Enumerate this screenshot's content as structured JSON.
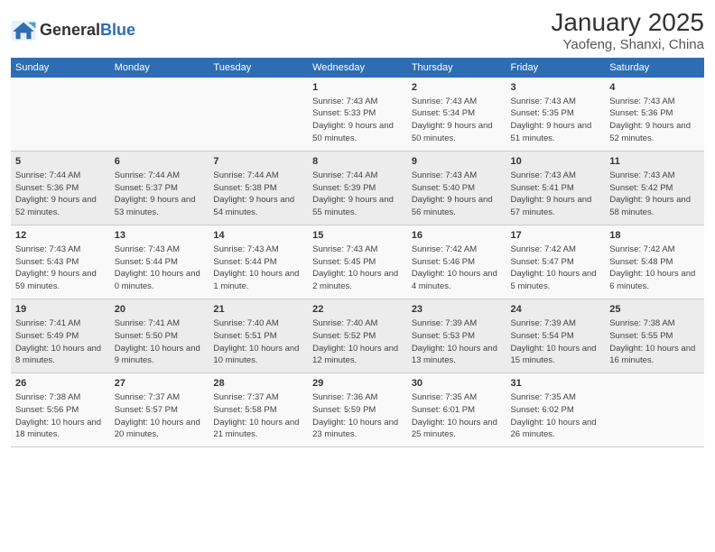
{
  "header": {
    "logo_general": "General",
    "logo_blue": "Blue",
    "title": "January 2025",
    "subtitle": "Yaofeng, Shanxi, China"
  },
  "weekdays": [
    "Sunday",
    "Monday",
    "Tuesday",
    "Wednesday",
    "Thursday",
    "Friday",
    "Saturday"
  ],
  "weeks": [
    [
      {
        "day": "",
        "sunrise": "",
        "sunset": "",
        "daylight": ""
      },
      {
        "day": "",
        "sunrise": "",
        "sunset": "",
        "daylight": ""
      },
      {
        "day": "",
        "sunrise": "",
        "sunset": "",
        "daylight": ""
      },
      {
        "day": "1",
        "sunrise": "Sunrise: 7:43 AM",
        "sunset": "Sunset: 5:33 PM",
        "daylight": "Daylight: 9 hours and 50 minutes."
      },
      {
        "day": "2",
        "sunrise": "Sunrise: 7:43 AM",
        "sunset": "Sunset: 5:34 PM",
        "daylight": "Daylight: 9 hours and 50 minutes."
      },
      {
        "day": "3",
        "sunrise": "Sunrise: 7:43 AM",
        "sunset": "Sunset: 5:35 PM",
        "daylight": "Daylight: 9 hours and 51 minutes."
      },
      {
        "day": "4",
        "sunrise": "Sunrise: 7:43 AM",
        "sunset": "Sunset: 5:36 PM",
        "daylight": "Daylight: 9 hours and 52 minutes."
      }
    ],
    [
      {
        "day": "5",
        "sunrise": "Sunrise: 7:44 AM",
        "sunset": "Sunset: 5:36 PM",
        "daylight": "Daylight: 9 hours and 52 minutes."
      },
      {
        "day": "6",
        "sunrise": "Sunrise: 7:44 AM",
        "sunset": "Sunset: 5:37 PM",
        "daylight": "Daylight: 9 hours and 53 minutes."
      },
      {
        "day": "7",
        "sunrise": "Sunrise: 7:44 AM",
        "sunset": "Sunset: 5:38 PM",
        "daylight": "Daylight: 9 hours and 54 minutes."
      },
      {
        "day": "8",
        "sunrise": "Sunrise: 7:44 AM",
        "sunset": "Sunset: 5:39 PM",
        "daylight": "Daylight: 9 hours and 55 minutes."
      },
      {
        "day": "9",
        "sunrise": "Sunrise: 7:43 AM",
        "sunset": "Sunset: 5:40 PM",
        "daylight": "Daylight: 9 hours and 56 minutes."
      },
      {
        "day": "10",
        "sunrise": "Sunrise: 7:43 AM",
        "sunset": "Sunset: 5:41 PM",
        "daylight": "Daylight: 9 hours and 57 minutes."
      },
      {
        "day": "11",
        "sunrise": "Sunrise: 7:43 AM",
        "sunset": "Sunset: 5:42 PM",
        "daylight": "Daylight: 9 hours and 58 minutes."
      }
    ],
    [
      {
        "day": "12",
        "sunrise": "Sunrise: 7:43 AM",
        "sunset": "Sunset: 5:43 PM",
        "daylight": "Daylight: 9 hours and 59 minutes."
      },
      {
        "day": "13",
        "sunrise": "Sunrise: 7:43 AM",
        "sunset": "Sunset: 5:44 PM",
        "daylight": "Daylight: 10 hours and 0 minutes."
      },
      {
        "day": "14",
        "sunrise": "Sunrise: 7:43 AM",
        "sunset": "Sunset: 5:44 PM",
        "daylight": "Daylight: 10 hours and 1 minute."
      },
      {
        "day": "15",
        "sunrise": "Sunrise: 7:43 AM",
        "sunset": "Sunset: 5:45 PM",
        "daylight": "Daylight: 10 hours and 2 minutes."
      },
      {
        "day": "16",
        "sunrise": "Sunrise: 7:42 AM",
        "sunset": "Sunset: 5:46 PM",
        "daylight": "Daylight: 10 hours and 4 minutes."
      },
      {
        "day": "17",
        "sunrise": "Sunrise: 7:42 AM",
        "sunset": "Sunset: 5:47 PM",
        "daylight": "Daylight: 10 hours and 5 minutes."
      },
      {
        "day": "18",
        "sunrise": "Sunrise: 7:42 AM",
        "sunset": "Sunset: 5:48 PM",
        "daylight": "Daylight: 10 hours and 6 minutes."
      }
    ],
    [
      {
        "day": "19",
        "sunrise": "Sunrise: 7:41 AM",
        "sunset": "Sunset: 5:49 PM",
        "daylight": "Daylight: 10 hours and 8 minutes."
      },
      {
        "day": "20",
        "sunrise": "Sunrise: 7:41 AM",
        "sunset": "Sunset: 5:50 PM",
        "daylight": "Daylight: 10 hours and 9 minutes."
      },
      {
        "day": "21",
        "sunrise": "Sunrise: 7:40 AM",
        "sunset": "Sunset: 5:51 PM",
        "daylight": "Daylight: 10 hours and 10 minutes."
      },
      {
        "day": "22",
        "sunrise": "Sunrise: 7:40 AM",
        "sunset": "Sunset: 5:52 PM",
        "daylight": "Daylight: 10 hours and 12 minutes."
      },
      {
        "day": "23",
        "sunrise": "Sunrise: 7:39 AM",
        "sunset": "Sunset: 5:53 PM",
        "daylight": "Daylight: 10 hours and 13 minutes."
      },
      {
        "day": "24",
        "sunrise": "Sunrise: 7:39 AM",
        "sunset": "Sunset: 5:54 PM",
        "daylight": "Daylight: 10 hours and 15 minutes."
      },
      {
        "day": "25",
        "sunrise": "Sunrise: 7:38 AM",
        "sunset": "Sunset: 5:55 PM",
        "daylight": "Daylight: 10 hours and 16 minutes."
      }
    ],
    [
      {
        "day": "26",
        "sunrise": "Sunrise: 7:38 AM",
        "sunset": "Sunset: 5:56 PM",
        "daylight": "Daylight: 10 hours and 18 minutes."
      },
      {
        "day": "27",
        "sunrise": "Sunrise: 7:37 AM",
        "sunset": "Sunset: 5:57 PM",
        "daylight": "Daylight: 10 hours and 20 minutes."
      },
      {
        "day": "28",
        "sunrise": "Sunrise: 7:37 AM",
        "sunset": "Sunset: 5:58 PM",
        "daylight": "Daylight: 10 hours and 21 minutes."
      },
      {
        "day": "29",
        "sunrise": "Sunrise: 7:36 AM",
        "sunset": "Sunset: 5:59 PM",
        "daylight": "Daylight: 10 hours and 23 minutes."
      },
      {
        "day": "30",
        "sunrise": "Sunrise: 7:35 AM",
        "sunset": "Sunset: 6:01 PM",
        "daylight": "Daylight: 10 hours and 25 minutes."
      },
      {
        "day": "31",
        "sunrise": "Sunrise: 7:35 AM",
        "sunset": "Sunset: 6:02 PM",
        "daylight": "Daylight: 10 hours and 26 minutes."
      },
      {
        "day": "",
        "sunrise": "",
        "sunset": "",
        "daylight": ""
      }
    ]
  ]
}
